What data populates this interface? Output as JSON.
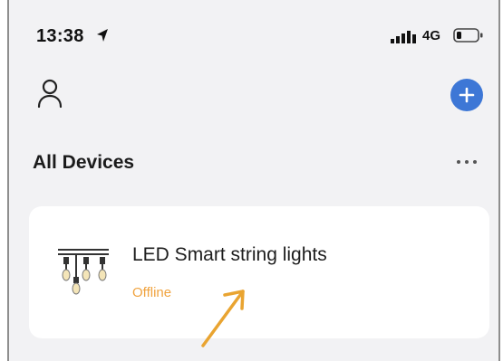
{
  "status_bar": {
    "time": "13:38",
    "network": "4G",
    "icons": [
      "location-arrow-icon",
      "signal-icon",
      "battery-icon"
    ]
  },
  "header": {
    "icons": [
      "profile-icon",
      "add-icon"
    ]
  },
  "section": {
    "title": "All Devices",
    "more_icon": "more-dots-icon"
  },
  "devices": [
    {
      "name": "LED Smart string lights",
      "status": "Offline",
      "icon": "string-lights-icon"
    }
  ],
  "annotation": {
    "icon": "pointer-arrow",
    "color": "#e9a431"
  },
  "colors": {
    "accent": "#3d77d6",
    "offline": "#f0a33f",
    "background": "#f2f2f4",
    "card": "#ffffff"
  }
}
